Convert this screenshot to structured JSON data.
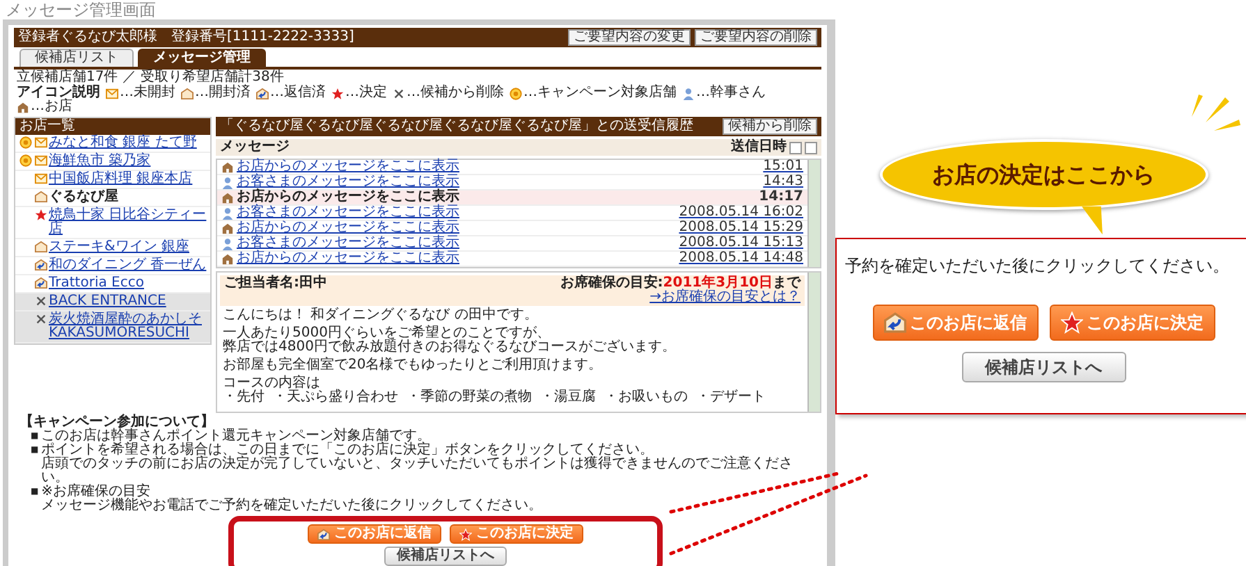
{
  "page_title": "メッセージ管理画面",
  "header": {
    "user": "登録者ぐるなび太郎様　登録番号[1111-2222-3333]",
    "buttons": [
      "ご要望内容の変更",
      "ご要望内容の削除"
    ]
  },
  "tabs": [
    {
      "label": "候補店リスト",
      "selected": false
    },
    {
      "label": "メッセージ管理",
      "selected": true
    }
  ],
  "counts": "立候補店舗17件 ／ 受取り希望店舗計38件",
  "legend": {
    "label": "アイコン説明",
    "items": [
      {
        "kind": "unopened",
        "text": "…未開封"
      },
      {
        "kind": "opened",
        "text": "…開封済"
      },
      {
        "kind": "replied",
        "text": "…返信済"
      },
      {
        "kind": "decided",
        "text": "…決定"
      },
      {
        "kind": "deleted",
        "text": "…候補から削除"
      },
      {
        "kind": "campaign",
        "text": "…キャンペーン対象店舗"
      },
      {
        "kind": "customer",
        "text": "…幹事さん"
      },
      {
        "kind": "shop",
        "text": "…お店"
      }
    ]
  },
  "shop_list": {
    "title": "お店一覧",
    "items": [
      {
        "lines": [
          "みなと和食 銀座 たて野"
        ],
        "kind": "unopened",
        "campaign": true,
        "selected": false
      },
      {
        "lines": [
          "海鮮魚市 築乃家"
        ],
        "kind": "unopened",
        "campaign": true,
        "selected": false
      },
      {
        "lines": [
          "中国飯店料理 銀座本店"
        ],
        "kind": "unopened",
        "campaign": false,
        "selected": false
      },
      {
        "lines": [
          "ぐるなび屋"
        ],
        "kind": "opened",
        "campaign": false,
        "selected": true
      },
      {
        "lines": [
          "焼鳥十家 日比谷シティー",
          "店"
        ],
        "kind": "decided",
        "campaign": false,
        "selected": false
      },
      {
        "lines": [
          "ステーキ&ワイン 銀座"
        ],
        "kind": "opened",
        "campaign": false,
        "selected": false
      },
      {
        "lines": [
          "和のダイニング 香一ぜん"
        ],
        "kind": "replied",
        "campaign": false,
        "selected": false
      },
      {
        "lines": [
          "Trattoria Ecco"
        ],
        "kind": "replied",
        "campaign": false,
        "selected": false
      },
      {
        "lines": [
          "BACK ENTRANCE"
        ],
        "kind": "deleted",
        "campaign": false,
        "selected": false
      },
      {
        "lines": [
          "炭火焼酒屋酔のあかしそ",
          "KAKASUMORESUCHI"
        ],
        "kind": "deleted",
        "campaign": false,
        "selected": false
      }
    ]
  },
  "history": {
    "title": "「ぐるなび屋ぐるなび屋ぐるなび屋ぐるなび屋ぐるなび屋」との送受信履歴",
    "remove_button": "候補から削除",
    "columns": [
      "メッセージ",
      "送信日時"
    ],
    "rows": [
      {
        "kind": "shop",
        "text": "お店からのメッセージをここに表示",
        "time": "15:01",
        "selected": false
      },
      {
        "kind": "customer",
        "text": "お客さまのメッセージをここに表示",
        "time": "14:43",
        "selected": false
      },
      {
        "kind": "shop",
        "text": "お店からのメッセージをここに表示",
        "time": "14:17",
        "selected": true
      },
      {
        "kind": "customer",
        "text": "お客さまのメッセージをここに表示",
        "time": "2008.05.14 16:02",
        "selected": false
      },
      {
        "kind": "shop",
        "text": "お店からのメッセージをここに表示",
        "time": "2008.05.14 15:29",
        "selected": false
      },
      {
        "kind": "customer",
        "text": "お客さまのメッセージをここに表示",
        "time": "2008.05.14 15:13",
        "selected": false
      },
      {
        "kind": "shop",
        "text": "お店からのメッセージをここに表示",
        "time": "2008.05.14 14:48",
        "selected": false
      }
    ]
  },
  "detail": {
    "contact": "ご担当者名:田中",
    "deadline_label": "お席確保の目安:",
    "deadline_date": "2011年3月10日",
    "deadline_suffix": "まで",
    "deadline_link": "→お席確保の目安とは？",
    "paragraphs": [
      [
        "こんにちは！ 和ダイニングぐるなび の田中です。"
      ],
      [
        "一人あたり5000円ぐらいをご希望とのことですが、",
        "弊店では4800円で飲み放題付きのお得なぐるなびコースがございます。"
      ],
      [
        "お部屋も完全個室で20名様でもゆったりとご利用頂けます。"
      ]
    ],
    "course_intro": "コースの内容は",
    "course_items": [
      "・先付",
      "・天ぷら盛り合わせ",
      "・季節の野菜の煮物",
      "・湯豆腐",
      "・お吸いもの",
      "・デザート"
    ]
  },
  "campaign": {
    "title": "【キャンペーン参加について】",
    "bullet": "■",
    "items": [
      [
        "このお店は幹事さんポイント還元キャンペーン対象店舗です。"
      ],
      [
        "ポイントを希望される場合は、この日までに「このお店に決定」ボタンをクリックしてください。",
        "店頭でのタッチの前にお店の決定が完了していないと、タッチいただいてもポイントは獲得できませんのでご注意ください。"
      ],
      [
        "※お席確保の目安",
        "メッセージ機能やお電話でご予約を確定いただいた後にクリックしてください。"
      ]
    ]
  },
  "actions": {
    "reply": "このお店に返信",
    "decide": "このお店に決定",
    "back": "候補店リストへ"
  },
  "callout": {
    "bubble": "お店の決定はここから",
    "text": "予約を確定いただいた後にクリックしてください。",
    "reply": "このお店に返信",
    "decide": "このお店に決定",
    "back": "候補店リストへ"
  }
}
